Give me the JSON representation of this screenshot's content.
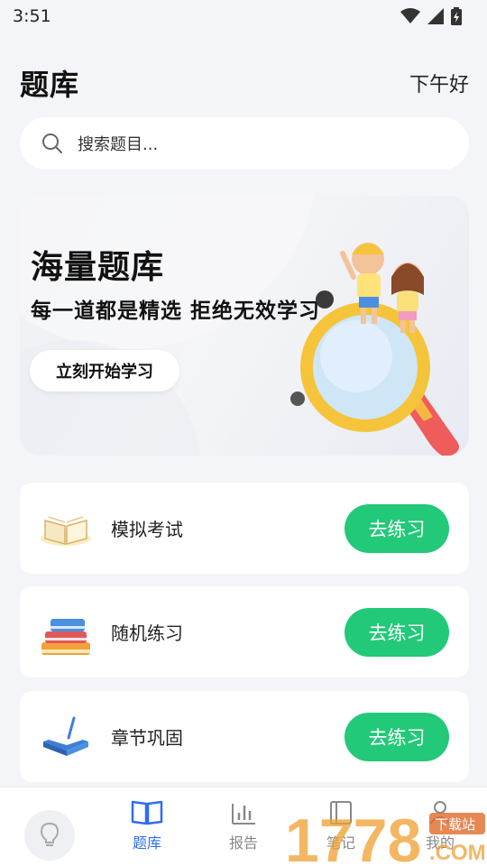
{
  "status_bar": {
    "time": "3:51"
  },
  "header": {
    "title": "题库",
    "greeting": "下午好"
  },
  "search": {
    "placeholder": "搜索题目..."
  },
  "banner": {
    "title": "海量题库",
    "subtitle": "每一道都是精选  拒绝无效学习",
    "button_label": "立刻开始学习"
  },
  "practice_items": [
    {
      "label": "模拟考试",
      "button_label": "去练习",
      "icon": "open-book-icon"
    },
    {
      "label": "随机练习",
      "button_label": "去练习",
      "icon": "book-stack-icon"
    },
    {
      "label": "章节巩固",
      "button_label": "去练习",
      "icon": "notebook-pen-icon"
    }
  ],
  "bottom_nav": {
    "items": [
      {
        "label": "题库",
        "icon": "book-icon",
        "active": true
      },
      {
        "label": "报告",
        "icon": "bar-chart-icon",
        "active": false
      },
      {
        "label": "笔记",
        "icon": "note-icon",
        "active": false
      },
      {
        "label": "我的",
        "icon": "profile-icon",
        "active": false
      }
    ]
  },
  "watermark": {
    "text": "1778",
    "site_label": "下载站",
    "suffix": ".COM"
  },
  "colors": {
    "accent_green": "#22c978",
    "nav_active": "#2f6df0",
    "background": "#f3f5f8"
  }
}
